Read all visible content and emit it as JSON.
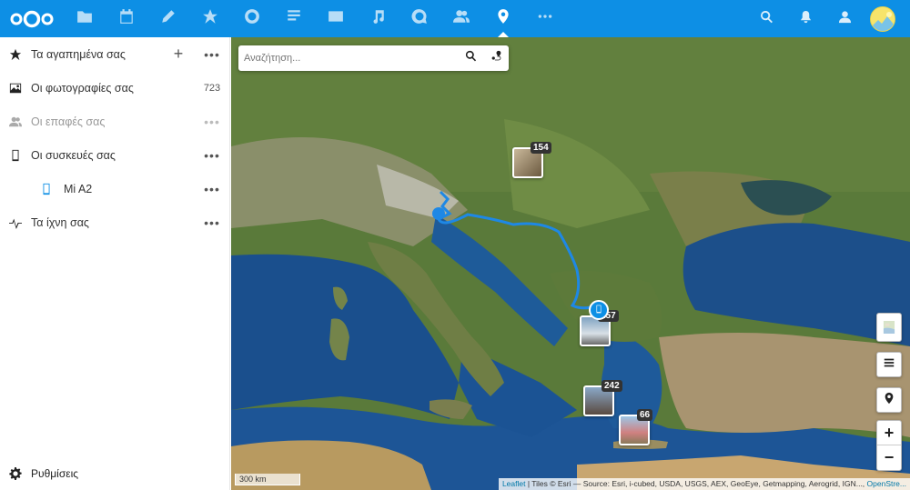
{
  "header": {
    "apps": [
      {
        "icon": "files-icon"
      },
      {
        "icon": "calendar-icon"
      },
      {
        "icon": "notes-icon"
      },
      {
        "icon": "favorites-icon"
      },
      {
        "icon": "circles-icon"
      },
      {
        "icon": "text-icon"
      },
      {
        "icon": "mail-icon"
      },
      {
        "icon": "music-icon"
      },
      {
        "icon": "talk-icon"
      },
      {
        "icon": "contacts-icon"
      },
      {
        "icon": "maps-icon",
        "active": true
      },
      {
        "icon": "more-apps-icon"
      }
    ]
  },
  "sidebar": {
    "favorites": {
      "label": "Τα αγαπημένα σας"
    },
    "photos": {
      "label": "Οι φωτογραφίες σας",
      "count": "723"
    },
    "contacts": {
      "label": "Οι επαφές σας"
    },
    "devices": {
      "label": "Οι συσκευές σας"
    },
    "device_mi": {
      "label": "Mi A2"
    },
    "tracks": {
      "label": "Τα ίχνη σας"
    },
    "settings": {
      "label": "Ρυθμίσεις"
    }
  },
  "map": {
    "search_placeholder": "Αναζήτηση...",
    "clusters": [
      {
        "count": "154"
      },
      {
        "count": "257"
      },
      {
        "count": "242"
      },
      {
        "count": "66"
      }
    ],
    "scale_label": "300 km",
    "attribution_link": "Leaflet",
    "attribution_text": " | Tiles © Esri — Source: Esri, i-cubed, USDA, USGS, AEX, GeoEye, Getmapping, Aerogrid, IGN..., ",
    "attribution_link2": "OpenStre..."
  }
}
